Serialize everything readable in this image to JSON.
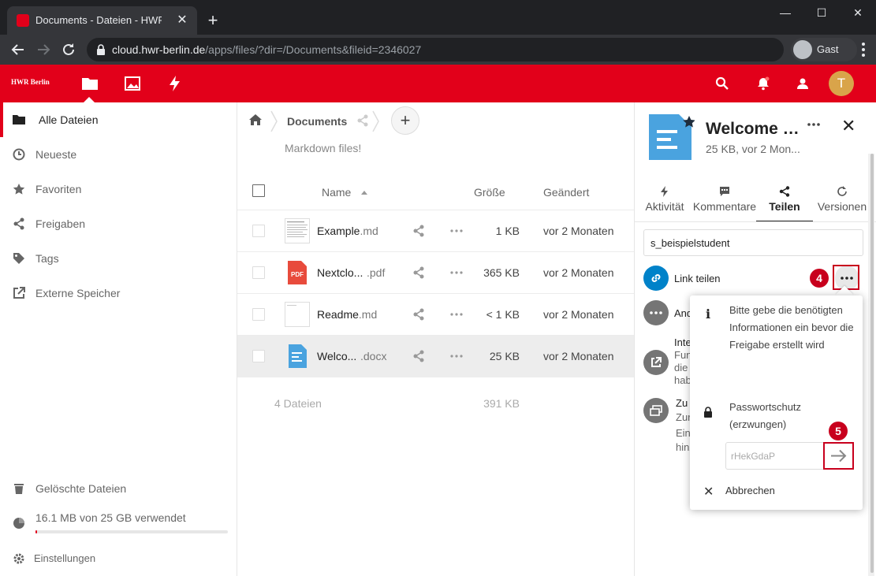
{
  "browser": {
    "tab_title": "Documents - Dateien - HWR Cloud",
    "url_host": "cloud.hwr-berlin.de",
    "url_path": "/apps/files/?dir=/Documents&fileid=2346027",
    "profile_label": "Gast"
  },
  "header": {
    "logo_text": "HWR Berlin",
    "user_initial": "T",
    "brand_color": "#e2001a"
  },
  "leftnav": {
    "items": [
      {
        "label": "Alle Dateien",
        "icon": "folder-icon"
      },
      {
        "label": "Neueste",
        "icon": "clock-icon"
      },
      {
        "label": "Favoriten",
        "icon": "star-icon"
      },
      {
        "label": "Freigaben",
        "icon": "share-icon"
      },
      {
        "label": "Tags",
        "icon": "tag-icon"
      },
      {
        "label": "Externe Speicher",
        "icon": "external-link-icon"
      }
    ],
    "trash_label": "Gelöschte Dateien",
    "quota_label": "16.1 MB von 25 GB verwendet",
    "quota_fraction": 0.0006,
    "settings_label": "Einstellungen"
  },
  "main": {
    "breadcrumb": "Documents",
    "rich_workspace": "Markdown files!",
    "columns": {
      "name": "Name",
      "size": "Größe",
      "modified": "Geändert"
    },
    "files": [
      {
        "name": "Example",
        "ext": ".md",
        "size": "1 KB",
        "modified": "vor 2 Monaten",
        "type": "text-thumb"
      },
      {
        "name": "Nextclo...",
        "ext": ".pdf",
        "size": "365 KB",
        "modified": "vor 2 Monaten",
        "type": "pdf-icon"
      },
      {
        "name": "Readme",
        "ext": ".md",
        "size": "< 1 KB",
        "modified": "vor 2 Monaten",
        "type": "blank-thumb"
      },
      {
        "name": "Welco...",
        "ext": ".docx",
        "size": "25 KB",
        "modified": "vor 2 Monaten",
        "type": "document-icon"
      }
    ],
    "pdf_badge": "PDF",
    "summary_count": "4 Dateien",
    "summary_size": "391 KB"
  },
  "sidebar": {
    "title": "Welcome t...",
    "subtitle": "25 KB, vor 2 Mon...",
    "tabs": [
      {
        "label": "Aktivität"
      },
      {
        "label": "Kommentare"
      },
      {
        "label": "Teilen"
      },
      {
        "label": "Versionen"
      }
    ],
    "share_input_value": "s_beispielstudent",
    "link_share_label": "Link teilen",
    "other_label": "And",
    "internal_line1": "Inte",
    "internal_line2": "Fun",
    "internal_line3": "die",
    "internal_line4": "hab",
    "project_line1": "Zu",
    "project_line2": "Zur",
    "project_line3": "Eint",
    "project_line4": "hinz"
  },
  "annotations": {
    "badge_4": "4",
    "badge_5": "5"
  },
  "popover": {
    "info_text": "Bitte gebe die benötigten Informationen ein bevor die Freigabe erstellt wird",
    "password_label": "Passwortschutz (erzwungen)",
    "password_value": "rHekGdaP",
    "cancel_label": "Abbrechen"
  }
}
